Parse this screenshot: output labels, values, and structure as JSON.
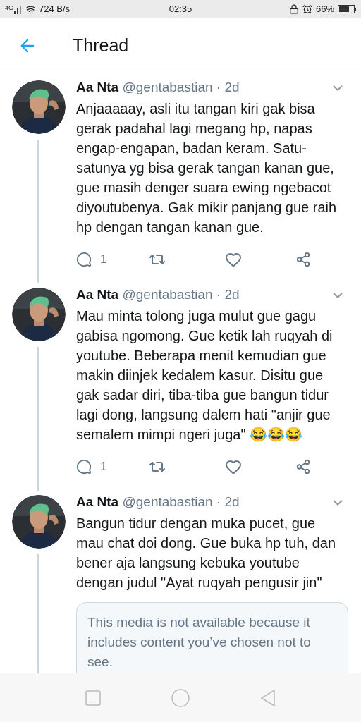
{
  "status_bar": {
    "network_type": "4G",
    "speed": "724 B/s",
    "time": "02:35",
    "battery": "66%"
  },
  "header": {
    "title": "Thread"
  },
  "tweets": [
    {
      "name": "Aa Nta",
      "handle": "@gentabastian · 2d",
      "text": "Anjaaaaay, asli itu tangan kiri gak bisa gerak padahal lagi megang hp, napas engap-engapan, badan keram. Satu-satunya yg bisa gerak tangan kanan gue, gue masih denger suara ewing ngebacot diyoutubenya. Gak mikir panjang gue raih hp dengan tangan kanan gue.",
      "replies": "1"
    },
    {
      "name": "Aa Nta",
      "handle": "@gentabastian · 2d",
      "text": "Mau minta tolong juga mulut gue gagu gabisa ngomong. Gue ketik lah ruqyah di youtube. Beberapa menit kemudian gue makin diinjek kedalem kasur. Disitu gue gak sadar diri, tiba-tiba gue bangun tidur lagi dong, langsung dalem hati \"anjir gue semalem mimpi ngeri juga\" 😂😂😂",
      "replies": "1"
    },
    {
      "name": "Aa Nta",
      "handle": "@gentabastian · 2d",
      "text": "Bangun tidur dengan muka pucet, gue mau chat doi dong. Gue buka hp tuh, dan bener aja langsung kebuka youtube dengan judul \"Ayat ruqyah pengusir jin\"",
      "media_notice": "This media is not available because it includes content you’ve chosen not to see."
    }
  ]
}
